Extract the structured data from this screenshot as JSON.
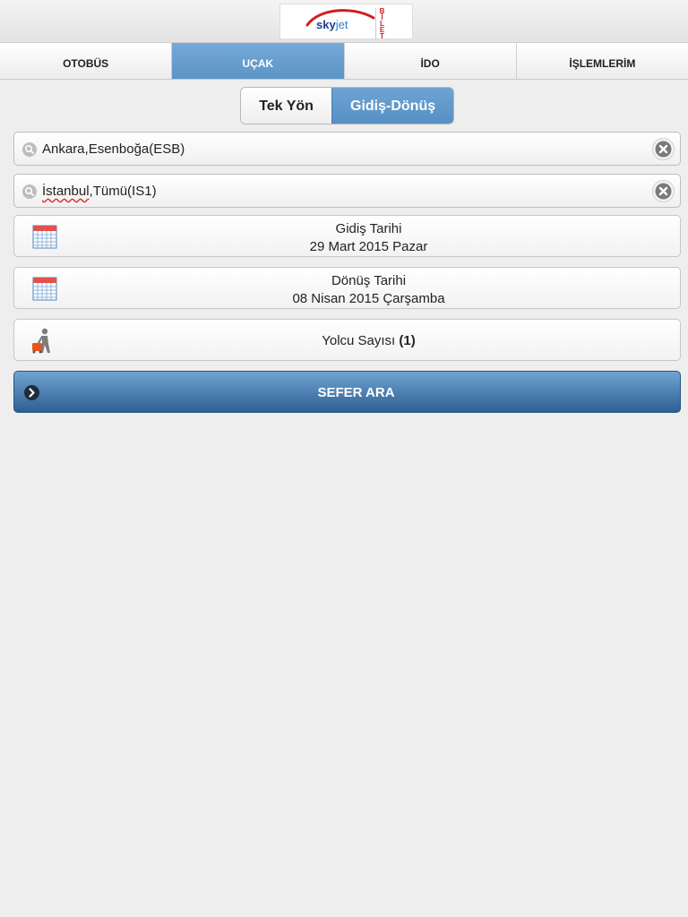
{
  "header": {
    "logo_text_sky": "sky",
    "logo_text_jet": "jet",
    "logo_text_bilet": "BİLET",
    "colors": {
      "brand_red": "#d01d20",
      "brand_blue": "#1d3f8f"
    }
  },
  "tabs": [
    {
      "label": "OTOBÜS",
      "active": false
    },
    {
      "label": "UÇAK",
      "active": true
    },
    {
      "label": "İDO",
      "active": false
    },
    {
      "label": "İŞLEMLERİM",
      "active": false
    }
  ],
  "trip_type": {
    "one_way": "Tek Yön",
    "round_trip": "Gidiş-Dönüş",
    "selected": "Gidiş-Dönüş"
  },
  "origin": {
    "value": "Ankara,Esenboğa(ESB)",
    "icon": "search-icon"
  },
  "destination": {
    "value_main": "İstanbul",
    "value_rest": ",Tümü(IS1)",
    "icon": "search-icon"
  },
  "departure": {
    "label": "Gidiş Tarihi",
    "date": "29 Mart 2015 Pazar",
    "icon": "calendar-icon"
  },
  "return": {
    "label": "Dönüş Tarihi",
    "date": "08 Nisan 2015 Çarşamba",
    "icon": "calendar-icon"
  },
  "passengers": {
    "label": "Yolcu Sayısı",
    "count": "(1)",
    "icon": "passenger-icon"
  },
  "search_button": {
    "label": "SEFER ARA",
    "icon": "chevron-right-icon"
  },
  "colors": {
    "accent": "#5b94c7",
    "button_dark": "#2f5f93",
    "background": "#eeeeee"
  }
}
